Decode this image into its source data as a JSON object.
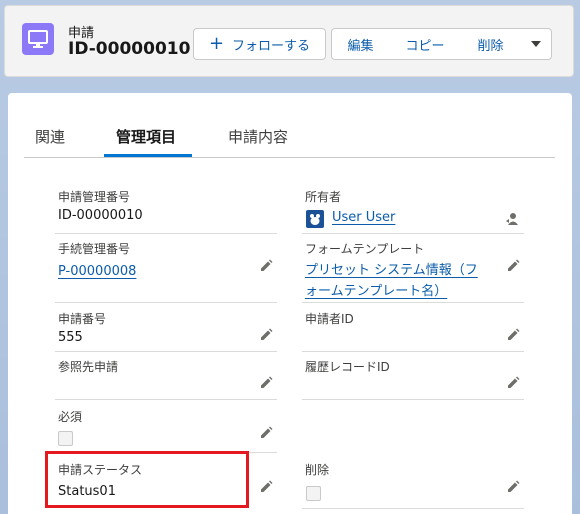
{
  "header": {
    "object_type": "申請",
    "record_name": "ID-00000010",
    "buttons": {
      "follow": "フォローする",
      "edit": "編集",
      "copy": "コピー",
      "delete": "削除"
    }
  },
  "tabs": [
    {
      "label": "関連"
    },
    {
      "label": "管理項目"
    },
    {
      "label": "申請内容"
    }
  ],
  "fields": {
    "request_mgmt_no": {
      "label": "申請管理番号",
      "value": "ID-00000010"
    },
    "owner": {
      "label": "所有者",
      "value": "User User"
    },
    "procedure_mgmt_no": {
      "label": "手続管理番号",
      "value": "P-00000008"
    },
    "form_template": {
      "label": "フォームテンプレート",
      "value_line1": "プリセット システム情報（フ",
      "value_line2": "ォームテンプレート名）"
    },
    "request_no": {
      "label": "申請番号",
      "value": "555"
    },
    "requester_id": {
      "label": "申請者ID",
      "value": ""
    },
    "ref_request": {
      "label": "参照先申請",
      "value": ""
    },
    "history_record_id": {
      "label": "履歴レコードID",
      "value": ""
    },
    "required": {
      "label": "必須",
      "checked": false
    },
    "request_status": {
      "label": "申請ステータス",
      "value": "Status01"
    },
    "deleted": {
      "label": "削除",
      "checked": false
    }
  },
  "colors": {
    "accent": "#0176d3",
    "link": "#0b5cab",
    "object_icon": "#8b79f7",
    "highlight": "#e3191f"
  },
  "icons": {
    "object": "desktop-icon",
    "edit": "pencil-icon",
    "more": "chevron-down-icon",
    "owner_change": "change-owner-icon",
    "avatar": "user-avatar"
  }
}
